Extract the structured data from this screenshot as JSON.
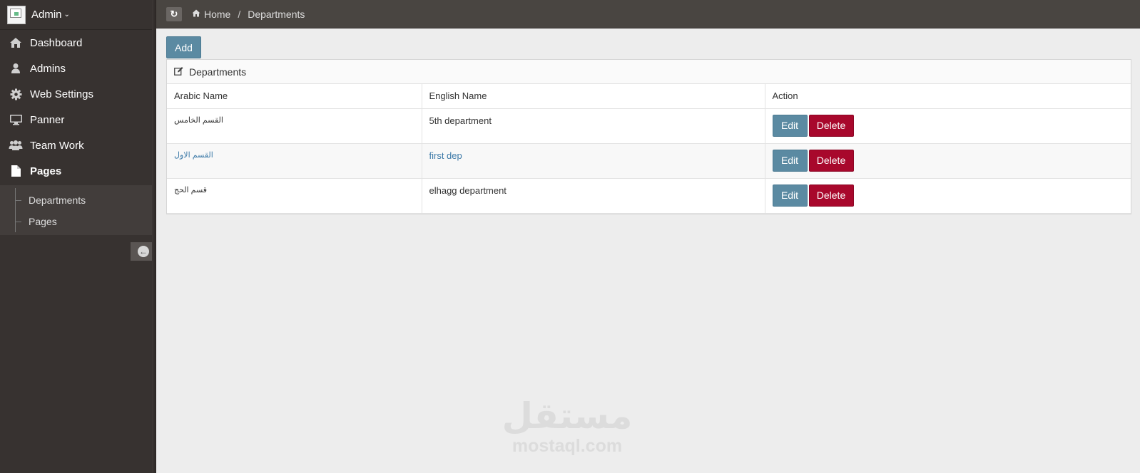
{
  "sidebar": {
    "user": {
      "name": "Admin",
      "caret": "⌵"
    },
    "items": [
      {
        "label": "Dashboard",
        "icon": "home-icon"
      },
      {
        "label": "Admins",
        "icon": "user-icon"
      },
      {
        "label": "Web Settings",
        "icon": "gear-icon"
      },
      {
        "label": "Panner",
        "icon": "monitor-icon"
      },
      {
        "label": "Team Work",
        "icon": "users-icon"
      },
      {
        "label": "Pages",
        "icon": "file-icon"
      }
    ],
    "submenu": [
      {
        "label": "Departments"
      },
      {
        "label": "Pages"
      }
    ]
  },
  "topbar": {
    "breadcrumb": [
      {
        "label": "Home"
      },
      {
        "label": "Departments"
      }
    ],
    "separator": "/"
  },
  "main": {
    "add_label": "Add",
    "panel_title": "Departments",
    "columns": [
      "Arabic Name",
      "English Name",
      "Action"
    ],
    "rows": [
      {
        "arabic": "القسم الخامس",
        "english": "5th department"
      },
      {
        "arabic": "القسم الاول",
        "english": "first dep"
      },
      {
        "arabic": "قسم الحج",
        "english": "elhagg department"
      }
    ],
    "edit_label": "Edit",
    "delete_label": "Delete"
  },
  "watermark": {
    "arabic": "مستقل",
    "english": "mostaql.com"
  },
  "colors": {
    "sidebar_bg": "#373230",
    "topbar_bg": "#494541",
    "primary": "#5b8aa2",
    "danger": "#a8082c",
    "link": "#3d7aa8"
  }
}
